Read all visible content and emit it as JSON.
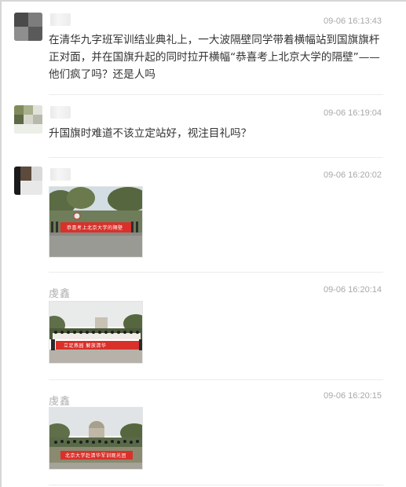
{
  "comments": [
    {
      "author": "",
      "time": "09-06 16:13:43",
      "text": "在清华九字班军训结业典礼上，一大波隔壁同学带着横幅站到国旗旗杆正对面，并在国旗升起的同时拉开横幅“恭喜考上北京大学的隔壁”——他们疯了吗？还是人吗"
    },
    {
      "author": "",
      "time": "09-06 16:19:04",
      "text": "升国旗时难道不该立定站好，视注目礼吗？"
    },
    {
      "author": "",
      "time": "09-06 16:20:02",
      "text": "",
      "photo_banner": "恭喜考上北京大学的隔壁"
    },
    {
      "author": "虔鑫",
      "time": "09-06 16:20:14",
      "text": "",
      "photo_banner": "立足燕园 解放清华"
    },
    {
      "author": "虔鑫",
      "time": "09-06 16:20:15",
      "text": "",
      "photo_banner": "北京大学赴清华军训观光团"
    }
  ],
  "colors": {
    "text": "#333333",
    "muted": "#a8a8a8",
    "banner_red": "#d9302a"
  }
}
